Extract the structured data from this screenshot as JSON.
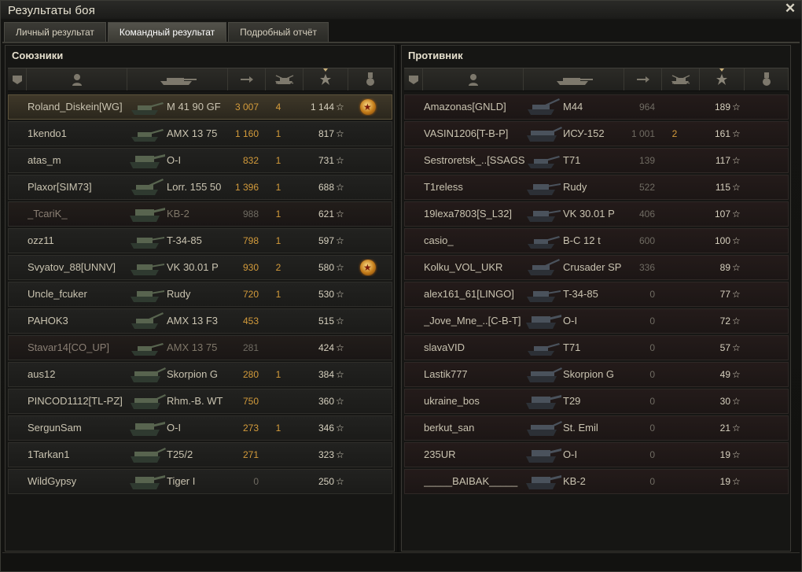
{
  "window": {
    "title": "Результаты боя",
    "close_icon": "close-icon"
  },
  "tabs": [
    {
      "label": "Личный результат",
      "active": false
    },
    {
      "label": "Командный результат",
      "active": true
    },
    {
      "label": "Подробный отчёт",
      "active": false
    }
  ],
  "columns": {
    "icons": [
      "squad-icon",
      "player-icon",
      "tank-icon",
      "damage-icon",
      "kills-icon",
      "xp-star-icon",
      "medal-icon"
    ],
    "sorted_by": "xp-star-icon"
  },
  "allies": {
    "title": "Союзники",
    "rows": [
      {
        "name": "Roland_Diskein[WG]",
        "vehicle": "M 41 90 GF",
        "damage": "3 007",
        "kills": "4",
        "xp": "1 144",
        "medal": true,
        "me": true,
        "dead": false,
        "tank": "light"
      },
      {
        "name": "1kendo1",
        "vehicle": "AMX 13 75",
        "damage": "1 160",
        "kills": "1",
        "xp": "817",
        "medal": false,
        "dead": false,
        "tank": "light"
      },
      {
        "name": "atas_m",
        "vehicle": "O-I",
        "damage": "832",
        "kills": "1",
        "xp": "731",
        "medal": false,
        "dead": false,
        "tank": "heavy"
      },
      {
        "name": "Plaxor[SIM73]",
        "vehicle": "Lorr. 155 50",
        "damage": "1 396",
        "kills": "1",
        "xp": "688",
        "medal": false,
        "dead": false,
        "tank": "spg"
      },
      {
        "name": "_TcariK_",
        "vehicle": "KB-2",
        "damage": "988",
        "kills": "1",
        "xp": "621",
        "medal": false,
        "dead": true,
        "tank": "heavy"
      },
      {
        "name": "ozz11",
        "vehicle": "T-34-85",
        "damage": "798",
        "kills": "1",
        "xp": "597",
        "medal": false,
        "dead": false,
        "tank": "medium"
      },
      {
        "name": "Svyatov_88[UNNV]",
        "vehicle": "VK 30.01 P",
        "damage": "930",
        "kills": "2",
        "xp": "580",
        "medal": true,
        "dead": false,
        "tank": "medium"
      },
      {
        "name": "Uncle_fcuker",
        "vehicle": "Rudy",
        "damage": "720",
        "kills": "1",
        "xp": "530",
        "medal": false,
        "dead": false,
        "tank": "medium"
      },
      {
        "name": "PAHOK3",
        "vehicle": "AMX 13 F3",
        "damage": "453",
        "kills": "",
        "xp": "515",
        "medal": false,
        "dead": false,
        "tank": "spg"
      },
      {
        "name": "Stavar14[CO_UP]",
        "vehicle": "AMX 13 75",
        "damage": "281",
        "kills": "",
        "xp": "424",
        "medal": false,
        "dead": true,
        "tank": "light"
      },
      {
        "name": "aus12",
        "vehicle": "Skorpion G",
        "damage": "280",
        "kills": "1",
        "xp": "384",
        "medal": false,
        "dead": false,
        "tank": "td"
      },
      {
        "name": "PINCOD1112[TL-PZ]",
        "vehicle": "Rhm.-B. WT",
        "damage": "750",
        "kills": "",
        "xp": "360",
        "medal": false,
        "dead": false,
        "tank": "td"
      },
      {
        "name": "SergunSam",
        "vehicle": "O-I",
        "damage": "273",
        "kills": "1",
        "xp": "346",
        "medal": false,
        "dead": false,
        "tank": "heavy"
      },
      {
        "name": "1Tarkan1",
        "vehicle": "T25/2",
        "damage": "271",
        "kills": "",
        "xp": "323",
        "medal": false,
        "dead": false,
        "tank": "td"
      },
      {
        "name": "WildGypsy",
        "vehicle": "Tiger I",
        "damage": "0",
        "kills": "",
        "xp": "250",
        "medal": false,
        "dead": false,
        "tank": "heavy"
      }
    ]
  },
  "enemies": {
    "title": "Противник",
    "rows": [
      {
        "name": "Amazonas[GNLD]",
        "vehicle": "M44",
        "damage": "964",
        "kills": "",
        "xp": "189",
        "tank": "spg"
      },
      {
        "name": "VASIN1206[T-B-P]",
        "vehicle": "ИСУ-152",
        "damage": "1 001",
        "kills": "2",
        "xp": "161",
        "tank": "td"
      },
      {
        "name": "Sestroretsk_..[SSAGS]",
        "vehicle": "T71",
        "damage": "139",
        "kills": "",
        "xp": "117",
        "tank": "light"
      },
      {
        "name": "T1reless",
        "vehicle": "Rudy",
        "damage": "522",
        "kills": "",
        "xp": "115",
        "tank": "medium"
      },
      {
        "name": "19lexa7803[S_L32]",
        "vehicle": "VK 30.01 P",
        "damage": "406",
        "kills": "",
        "xp": "107",
        "tank": "medium"
      },
      {
        "name": "casio_",
        "vehicle": "B-C 12 t",
        "damage": "600",
        "kills": "",
        "xp": "100",
        "tank": "light"
      },
      {
        "name": "Kolku_VOL_UKR",
        "vehicle": "Crusader SP",
        "damage": "336",
        "kills": "",
        "xp": "89",
        "tank": "spg"
      },
      {
        "name": "alex161_61[LINGO]",
        "vehicle": "T-34-85",
        "damage": "0",
        "kills": "",
        "xp": "77",
        "tank": "medium"
      },
      {
        "name": "_Jove_Mne_..[C-B-T]",
        "vehicle": "O-I",
        "damage": "0",
        "kills": "",
        "xp": "72",
        "tank": "heavy"
      },
      {
        "name": "slavaVID",
        "vehicle": "T71",
        "damage": "0",
        "kills": "",
        "xp": "57",
        "tank": "light"
      },
      {
        "name": "Lastik777",
        "vehicle": "Skorpion G",
        "damage": "0",
        "kills": "",
        "xp": "49",
        "tank": "td"
      },
      {
        "name": "ukraine_bos",
        "vehicle": "T29",
        "damage": "0",
        "kills": "",
        "xp": "30",
        "tank": "heavy"
      },
      {
        "name": "berkut_san",
        "vehicle": "St. Emil",
        "damage": "0",
        "kills": "",
        "xp": "21",
        "tank": "td"
      },
      {
        "name": "235UR",
        "vehicle": "O-I",
        "damage": "0",
        "kills": "",
        "xp": "19",
        "tank": "heavy"
      },
      {
        "name": "_____BAIBAK_____",
        "vehicle": "KB-2",
        "damage": "0",
        "kills": "",
        "xp": "19",
        "tank": "heavy"
      }
    ]
  },
  "star_glyph": "☆",
  "colors": {
    "damage": "#d39b3b",
    "highlight_row": "#3f3829",
    "enemy_row": "#241b1a"
  }
}
